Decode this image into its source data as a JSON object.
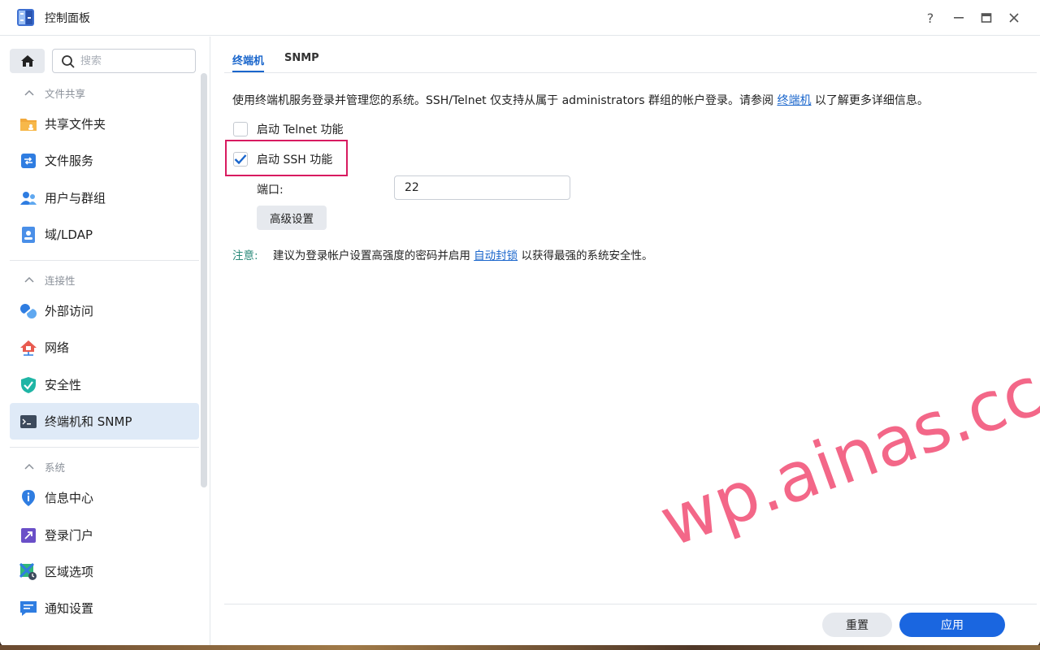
{
  "window": {
    "title": "控制面板",
    "buttons": {
      "help": "?",
      "minimize": "—",
      "maximize": "▣",
      "close": "✕"
    }
  },
  "sidebar": {
    "search_placeholder": "搜索",
    "sections": [
      {
        "label": "文件共享",
        "items": [
          "共享文件夹",
          "文件服务",
          "用户与群组",
          "域/LDAP"
        ]
      },
      {
        "label": "连接性",
        "items": [
          "外部访问",
          "网络",
          "安全性",
          "终端机和 SNMP"
        ]
      },
      {
        "label": "系统",
        "items": [
          "信息中心",
          "登录门户",
          "区域选项",
          "通知设置"
        ]
      }
    ],
    "active_item": "终端机和 SNMP"
  },
  "tabs": [
    "终端机",
    "SNMP"
  ],
  "active_tab": "终端机",
  "content": {
    "description_before": "使用终端机服务登录并管理您的系统。SSH/Telnet 仅支持从属于 administrators 群组的帐户登录。请参阅",
    "description_link": "终端机",
    "description_after": "以了解更多详细信息。",
    "telnet_label": "启动 Telnet 功能",
    "telnet_checked": false,
    "ssh_label": "启动 SSH 功能",
    "ssh_checked": true,
    "port_label": "端口:",
    "port_value": "22",
    "advanced_button": "高级设置",
    "note_label": "注意:",
    "note_before": "建议为登录帐户设置高强度的密码并启用",
    "note_link": "自动封锁",
    "note_after": "以获得最强的系统安全性。"
  },
  "footer": {
    "reset": "重置",
    "apply": "应用"
  },
  "watermark": "wp.ainas.cc",
  "colors": {
    "accent": "#1a66cc",
    "highlight": "#d81b60",
    "note": "#2a8a7a",
    "active_bg": "#dfeaf7"
  }
}
